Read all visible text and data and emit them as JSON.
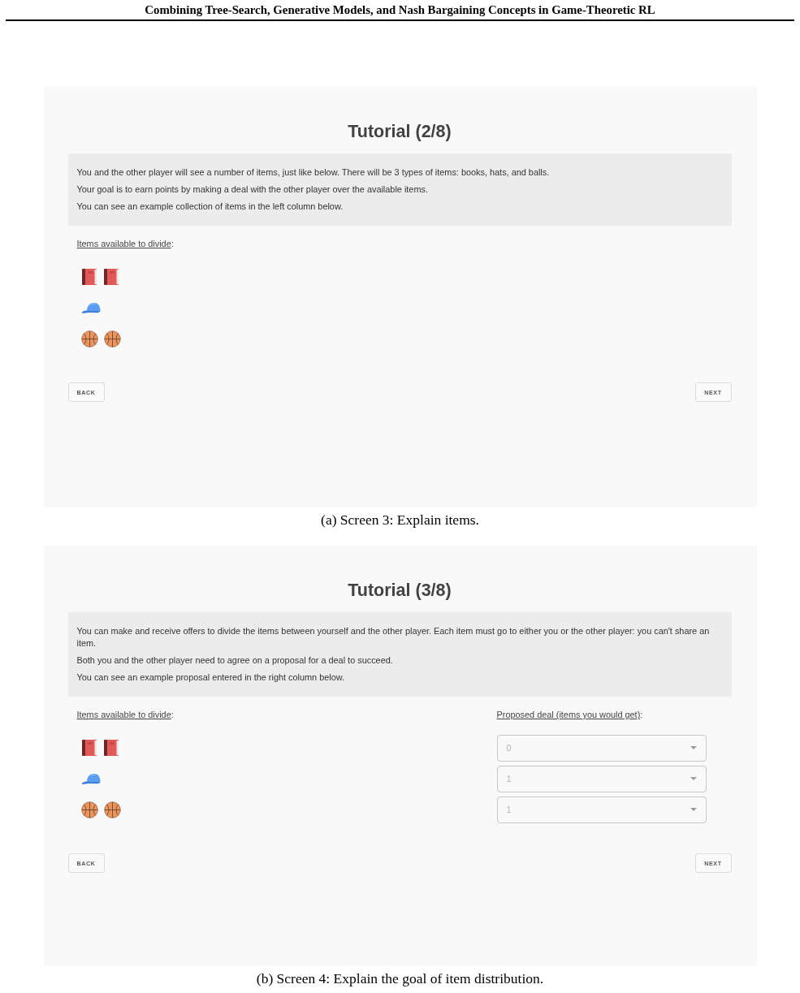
{
  "header": {
    "title": "Combining Tree-Search, Generative Models, and Nash Bargaining Concepts in Game-Theoretic RL"
  },
  "figures": [
    {
      "screen": {
        "title": "Tutorial (2/8)",
        "instructions": [
          "You and the other player will see a number of items, just like below. There will be 3 types of items: books, hats, and balls.",
          "Your goal is to earn points by making a deal with the other player over the available items.",
          "You can see an example collection of items in the left column below."
        ],
        "items_column": {
          "label": "Items available to divide",
          "label_suffix": ":",
          "rows": [
            {
              "icons": [
                {
                  "kind": "book"
                },
                {
                  "kind": "book"
                }
              ]
            },
            {
              "icons": [
                {
                  "kind": "cap"
                }
              ]
            },
            {
              "icons": [
                {
                  "kind": "basketball"
                },
                {
                  "kind": "basketball"
                }
              ]
            }
          ]
        },
        "buttons": [
          {
            "label": "BACK"
          },
          {
            "label": "NEXT"
          }
        ]
      },
      "caption": "(a) Screen 3: Explain items."
    },
    {
      "screen": {
        "title": "Tutorial (3/8)",
        "instructions": [
          "You can make and receive offers to divide the items between yourself and the other player. Each item must go to either you or the other player: you can't share an item.",
          "Both you and the other player need to agree on a proposal for a deal to succeed.",
          "You can see an example proposal entered in the right column below."
        ],
        "items_column": {
          "label": "Items available to divide",
          "label_suffix": ":",
          "rows": [
            {
              "icons": [
                {
                  "kind": "book"
                },
                {
                  "kind": "book"
                }
              ]
            },
            {
              "icons": [
                {
                  "kind": "cap"
                }
              ]
            },
            {
              "icons": [
                {
                  "kind": "basketball"
                },
                {
                  "kind": "basketball"
                }
              ]
            }
          ]
        },
        "proposal_column": {
          "label": "Proposed deal (items you would get)",
          "label_suffix": ":",
          "dropdowns": [
            {
              "value": "0",
              "disabled": true
            },
            {
              "value": "1",
              "disabled": true
            },
            {
              "value": "1",
              "disabled": true
            }
          ]
        },
        "buttons": [
          {
            "label": "BACK"
          },
          {
            "label": "NEXT"
          }
        ]
      },
      "caption": "(b) Screen 4: Explain the goal of item distribution."
    }
  ]
}
